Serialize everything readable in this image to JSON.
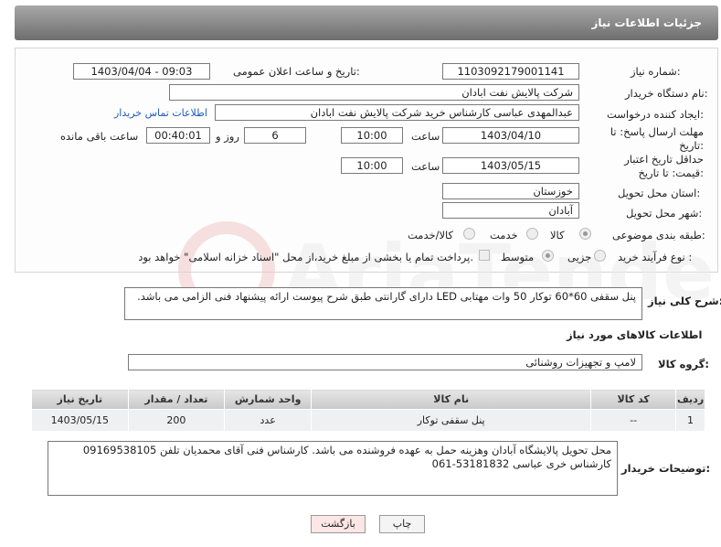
{
  "header": {
    "title": "جزئیات اطلاعات نیاز"
  },
  "fields": {
    "need_number_label": "شماره نیاز:",
    "need_number": "1103092179001141",
    "announce_label": "تاریخ و ساعت اعلان عمومی:",
    "announce_value": "1403/04/04 - 09:03",
    "buyer_org_label": "نام دستگاه خریدار:",
    "buyer_org": "شرکت پالایش نفت ابادان",
    "creator_label": "ایجاد کننده درخواست:",
    "creator": "عبدالمهدی  عباسی کارشناس خرید شرکت پالایش نفت ابادان",
    "contact_link": "اطلاعات تماس خریدار",
    "deadline_label": "مهلت ارسال پاسخ: تا تاریخ:",
    "deadline_date": "1403/04/10",
    "time_label": "ساعت",
    "deadline_time": "10:00",
    "days": "6",
    "days_label": "روز و",
    "remaining": "00:40:01",
    "remaining_label": "ساعت باقی مانده",
    "validity_label": "حداقل تاریخ اعتبار قیمت: تا تاریخ:",
    "validity_date": "1403/05/15",
    "validity_time": "10:00",
    "province_label": "استان محل تحویل:",
    "province": "خوزستان",
    "city_label": "شهر محل تحویل:",
    "city": "آبادان",
    "category_label": "طبقه بندی موضوعی:",
    "category_options": [
      "کالا",
      "خدمت",
      "کالا/خدمت"
    ],
    "process_label": "نوع فرآیند خرید :",
    "process_options": [
      "جزیی",
      "متوسط"
    ],
    "payment_note": "پرداخت تمام یا بخشی از مبلغ خرید،از محل \"اسناد خزانه اسلامی\" خواهد بود."
  },
  "description": {
    "label": "شرح کلی نیاز:",
    "text": "پنل سقفی 60*60 توکار 50 وات مهتابی LED دارای گارانتی طبق شرح پیوست ارائه پیشنهاد فنی الزامی می باشد."
  },
  "goods": {
    "section_title": "اطلاعات کالاهای مورد نیاز",
    "group_label": "گروه کالا:",
    "group_value": "لامپ و تجهیزات روشنائی",
    "columns": [
      "ردیف",
      "کد کالا",
      "نام کالا",
      "واحد شمارش",
      "تعداد / مقدار",
      "تاریخ نیاز"
    ],
    "rows": [
      [
        "1",
        "--",
        "پنل سقفی توکار",
        "عدد",
        "200",
        "1403/05/15"
      ]
    ]
  },
  "buyer_notes": {
    "label": "توضیحات خریدار:",
    "text": "محل تحویل پالایشگاه آبادان وهزینه حمل به عهده فروشنده می باشد. کارشناس فنی آقای محمدیان تلفن 09169538105 کارشناس خری عباسی 53181832-061"
  },
  "buttons": {
    "print": "چاپ",
    "back": "بازگشت"
  },
  "watermark": "AriaTender.neT"
}
